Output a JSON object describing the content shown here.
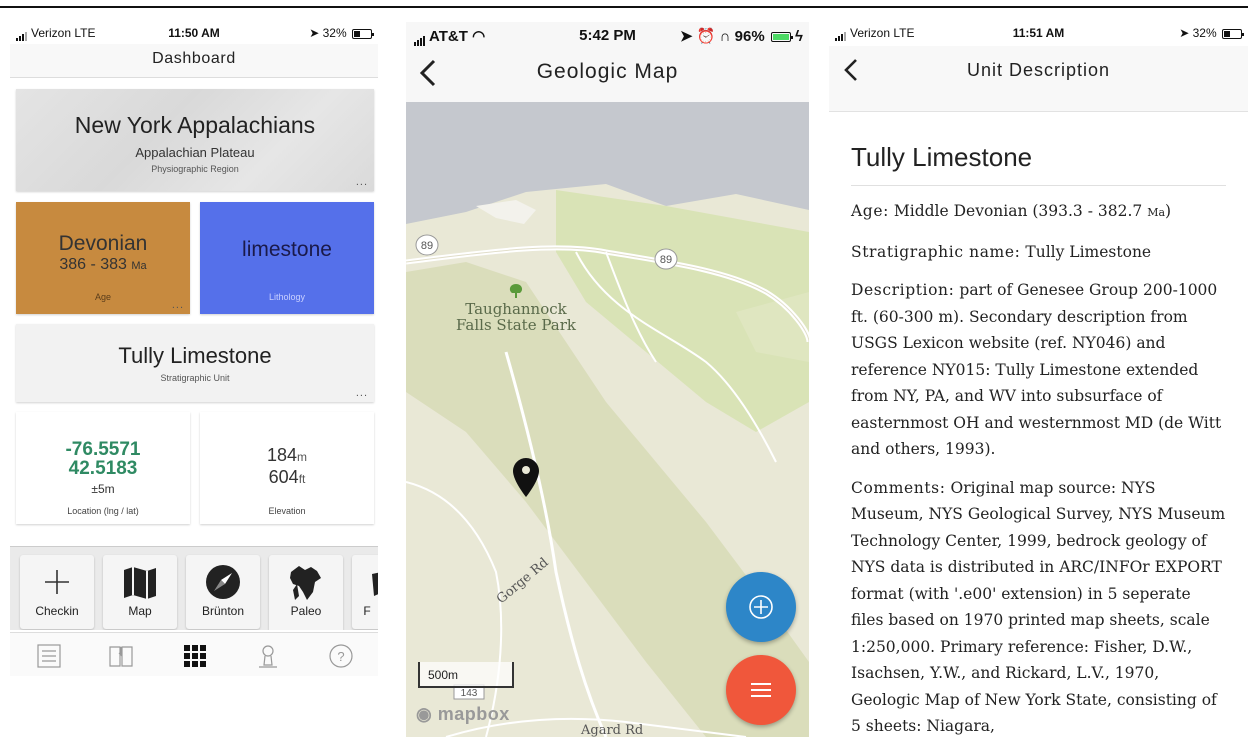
{
  "colors": {
    "age_card": "#c78a3f",
    "lithology_card": "#5570ea",
    "location_text": "#2f8a63",
    "fab_plus": "#2d86c8",
    "fab_menu": "#f0573b",
    "map_water": "#c5c8ce",
    "map_land": "#e9e8d6",
    "map_green": "#d9e3b6"
  },
  "dashboard": {
    "status": {
      "carrier": "Verizon",
      "network": "LTE",
      "time": "11:50 AM",
      "battery": "32%"
    },
    "title": "Dashboard",
    "region_card": {
      "title": "New York Appalachians",
      "subtitle": "Appalachian Plateau",
      "label": "Physiographic Region",
      "more": "..."
    },
    "age_card": {
      "period": "Devonian",
      "range": "386 - 383",
      "unit": "Ma",
      "label": "Age",
      "more": "..."
    },
    "lithology_card": {
      "value": "limestone",
      "label": "Lithology"
    },
    "unit_card": {
      "title": "Tully Limestone",
      "label": "Stratigraphic Unit",
      "more": "..."
    },
    "location_card": {
      "lng": "-76.5571",
      "lat": "42.5183",
      "accuracy": "±5m",
      "label": "Location (lng / lat)"
    },
    "elevation_card": {
      "meters": "184",
      "m_unit": "m",
      "feet": "604",
      "ft_unit": "ft",
      "label": "Elevation"
    },
    "tools": [
      {
        "label": "Checkin",
        "icon": "plus-icon"
      },
      {
        "label": "Map",
        "icon": "map-icon"
      },
      {
        "label": "Brünton",
        "icon": "compass-icon"
      },
      {
        "label": "Paleo",
        "icon": "paleo-map-icon"
      },
      {
        "label": "F",
        "icon": "partial-tool-icon"
      }
    ],
    "tabs": [
      {
        "icon": "list-icon",
        "active": false
      },
      {
        "icon": "book-icon",
        "active": false
      },
      {
        "icon": "grid-icon",
        "active": true
      },
      {
        "icon": "person-icon",
        "active": false
      },
      {
        "icon": "help-icon",
        "active": false
      }
    ]
  },
  "map_screen": {
    "status": {
      "carrier": "AT&T",
      "time": "5:42 PM",
      "battery": "96%"
    },
    "title": "Geologic Map",
    "labels": {
      "park_line1": "Taughannock",
      "park_line2": "Falls State Park",
      "road_89_a": "89",
      "road_89_b": "89",
      "gorge_rd": "Gorge Rd",
      "agard_rd": "Agard Rd",
      "route_143": "143"
    },
    "scale": "500m",
    "attribution": "mapbox"
  },
  "unit_screen": {
    "status": {
      "carrier": "Verizon",
      "network": "LTE",
      "time": "11:51 AM",
      "battery": "32%"
    },
    "title": "Unit Description",
    "heading": "Tully Limestone",
    "age_key": "Age:",
    "age_val": "Middle Devonian (393.3 - 382.7",
    "age_unit": "Ma",
    "age_close": ")",
    "strat_key": "Stratigraphic name:",
    "strat_val": "Tully Limestone",
    "desc_key": "Description:",
    "desc_val": "part of Genesee Group 200-1000 ft. (60-300 m). Secondary description from USGS Lexicon website (ref. NY046) and reference NY015: Tully Limestone extended from NY, PA, and WV into subsurface of easternmost OH and westernmost MD (de Witt and others, 1993).",
    "comments_key": "Comments:",
    "comments_val": "Original map source: NYS Museum, NYS Geological Survey, NYS Museum Technology Center, 1999, bedrock geology of NYS data is distributed in ARC/INFOr EXPORT format (with '.e00' extension) in 5 seperate files based on 1970 printed map sheets, scale 1:250,000. Primary reference: Fisher, D.W., Isachsen, Y.W., and Rickard, L.V., 1970, Geologic Map of New York State, consisting of 5 sheets: Niagara,"
  }
}
